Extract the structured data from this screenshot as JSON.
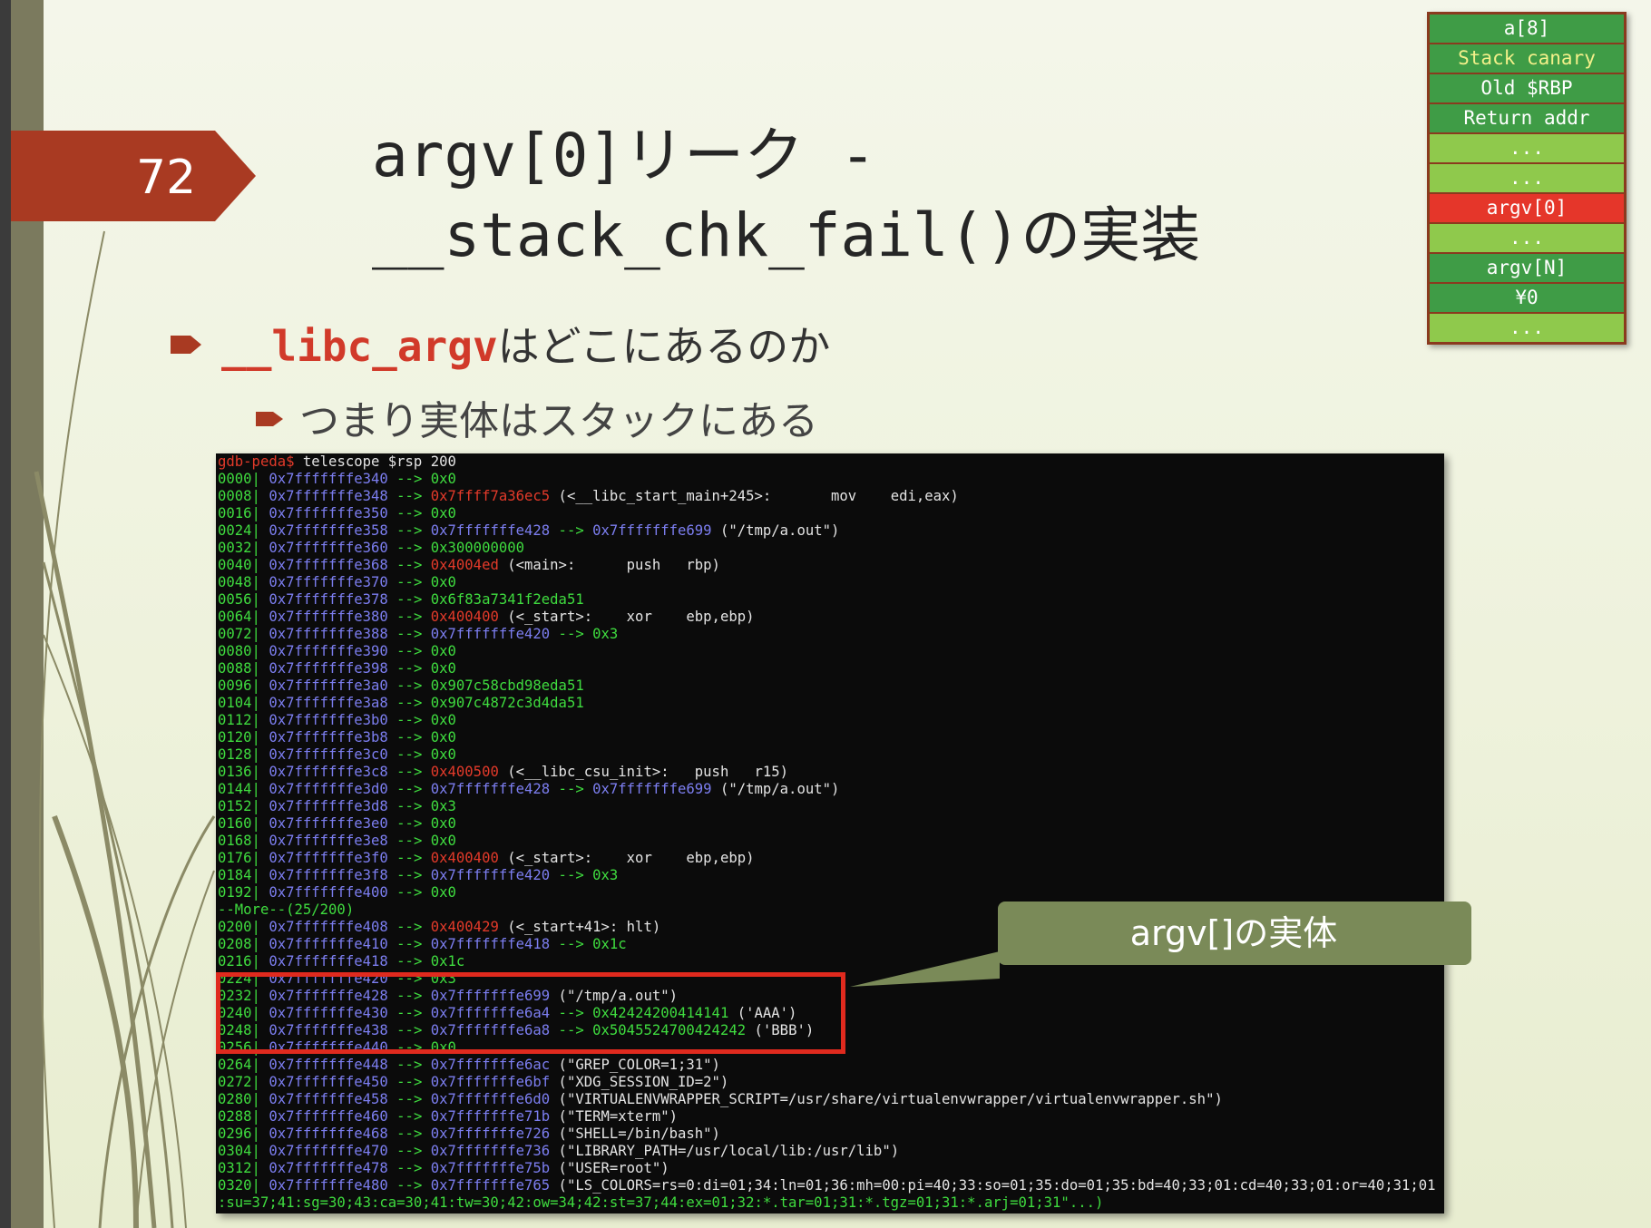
{
  "slide": {
    "number": "72",
    "title_line1": "argv[0]リーク -",
    "title_line2": "__stack_chk_fail()の実装",
    "bullet1_code": "__libc_argv",
    "bullet1_text": "はどこにあるのか",
    "bullet2_text": "つまり実体はスタックにある",
    "callout": "argv[]の実体"
  },
  "colors": {
    "badge": "#a93a22",
    "accent_red": "#d13a2a",
    "stack_dark": "#3f9c46",
    "stack_light": "#8fc94c",
    "stack_red": "#e5362a",
    "stack_border": "#8a3a1e",
    "callout": "#7a8a58",
    "terminal_bg": "#0b0b0b"
  },
  "stack_diagram": [
    {
      "label": "a[8]",
      "style": "dark"
    },
    {
      "label": "Stack canary",
      "style": "dark-yellow"
    },
    {
      "label": "Old $RBP",
      "style": "dark"
    },
    {
      "label": "Return addr",
      "style": "dark"
    },
    {
      "label": "...",
      "style": "light"
    },
    {
      "label": "...",
      "style": "light"
    },
    {
      "label": "argv[0]",
      "style": "red"
    },
    {
      "label": "...",
      "style": "light"
    },
    {
      "label": "argv[N]",
      "style": "dark"
    },
    {
      "label": "¥0",
      "style": "dark"
    },
    {
      "label": "...",
      "style": "light"
    }
  ],
  "terminal": {
    "prompt": "gdb-peda$",
    "command": " telescope $rsp 200",
    "lines": [
      {
        "off": "0000|",
        "addr": " 0x7fffffffe340",
        "arrow": " --> ",
        "v1": "0x0",
        "v1c": "g"
      },
      {
        "off": "0008|",
        "addr": " 0x7fffffffe348",
        "arrow": " --> ",
        "v1": "0x7ffff7a36ec5",
        "v1c": "r",
        "rest": " (<__libc_start_main+245>:       mov    edi,eax)"
      },
      {
        "off": "0016|",
        "addr": " 0x7fffffffe350",
        "arrow": " --> ",
        "v1": "0x0",
        "v1c": "g"
      },
      {
        "off": "0024|",
        "addr": " 0x7fffffffe358",
        "arrow": " --> ",
        "v1": "0x7fffffffe428",
        "v1c": "a",
        "mid": " --> ",
        "v2": "0x7fffffffe699",
        "v2c": "a",
        "rest": " (\"/tmp/a.out\")"
      },
      {
        "off": "0032|",
        "addr": " 0x7fffffffe360",
        "arrow": " --> ",
        "v1": "0x300000000",
        "v1c": "g"
      },
      {
        "off": "0040|",
        "addr": " 0x7fffffffe368",
        "arrow": " --> ",
        "v1": "0x4004ed",
        "v1c": "r",
        "rest": " (<main>:      push   rbp)"
      },
      {
        "off": "0048|",
        "addr": " 0x7fffffffe370",
        "arrow": " --> ",
        "v1": "0x0",
        "v1c": "g"
      },
      {
        "off": "0056|",
        "addr": " 0x7fffffffe378",
        "arrow": " --> ",
        "v1": "0x6f83a7341f2eda51",
        "v1c": "g"
      },
      {
        "off": "0064|",
        "addr": " 0x7fffffffe380",
        "arrow": " --> ",
        "v1": "0x400400",
        "v1c": "r",
        "rest": " (<_start>:    xor    ebp,ebp)"
      },
      {
        "off": "0072|",
        "addr": " 0x7fffffffe388",
        "arrow": " --> ",
        "v1": "0x7fffffffe420",
        "v1c": "a",
        "mid": " --> ",
        "v2": "0x3",
        "v2c": "g"
      },
      {
        "off": "0080|",
        "addr": " 0x7fffffffe390",
        "arrow": " --> ",
        "v1": "0x0",
        "v1c": "g"
      },
      {
        "off": "0088|",
        "addr": " 0x7fffffffe398",
        "arrow": " --> ",
        "v1": "0x0",
        "v1c": "g"
      },
      {
        "off": "0096|",
        "addr": " 0x7fffffffe3a0",
        "arrow": " --> ",
        "v1": "0x907c58cbd98eda51",
        "v1c": "g"
      },
      {
        "off": "0104|",
        "addr": " 0x7fffffffe3a8",
        "arrow": " --> ",
        "v1": "0x907c4872c3d4da51",
        "v1c": "g"
      },
      {
        "off": "0112|",
        "addr": " 0x7fffffffe3b0",
        "arrow": " --> ",
        "v1": "0x0",
        "v1c": "g"
      },
      {
        "off": "0120|",
        "addr": " 0x7fffffffe3b8",
        "arrow": " --> ",
        "v1": "0x0",
        "v1c": "g"
      },
      {
        "off": "0128|",
        "addr": " 0x7fffffffe3c0",
        "arrow": " --> ",
        "v1": "0x0",
        "v1c": "g"
      },
      {
        "off": "0136|",
        "addr": " 0x7fffffffe3c8",
        "arrow": " --> ",
        "v1": "0x400500",
        "v1c": "r",
        "rest": " (<__libc_csu_init>:   push   r15)"
      },
      {
        "off": "0144|",
        "addr": " 0x7fffffffe3d0",
        "arrow": " --> ",
        "v1": "0x7fffffffe428",
        "v1c": "a",
        "mid": " --> ",
        "v2": "0x7fffffffe699",
        "v2c": "a",
        "rest": " (\"/tmp/a.out\")"
      },
      {
        "off": "0152|",
        "addr": " 0x7fffffffe3d8",
        "arrow": " --> ",
        "v1": "0x3",
        "v1c": "g"
      },
      {
        "off": "0160|",
        "addr": " 0x7fffffffe3e0",
        "arrow": " --> ",
        "v1": "0x0",
        "v1c": "g"
      },
      {
        "off": "0168|",
        "addr": " 0x7fffffffe3e8",
        "arrow": " --> ",
        "v1": "0x0",
        "v1c": "g"
      },
      {
        "off": "0176|",
        "addr": " 0x7fffffffe3f0",
        "arrow": " --> ",
        "v1": "0x400400",
        "v1c": "r",
        "rest": " (<_start>:    xor    ebp,ebp)"
      },
      {
        "off": "0184|",
        "addr": " 0x7fffffffe3f8",
        "arrow": " --> ",
        "v1": "0x7fffffffe420",
        "v1c": "a",
        "mid": " --> ",
        "v2": "0x3",
        "v2c": "g"
      },
      {
        "off": "0192|",
        "addr": " 0x7fffffffe400",
        "arrow": " --> ",
        "v1": "0x0",
        "v1c": "g"
      },
      {
        "raw": "--More--(25/200)"
      },
      {
        "off": "0200|",
        "addr": " 0x7fffffffe408",
        "arrow": " --> ",
        "v1": "0x400429",
        "v1c": "r",
        "rest": " (<_start+41>: hlt)"
      },
      {
        "off": "0208|",
        "addr": " 0x7fffffffe410",
        "arrow": " --> ",
        "v1": "0x7fffffffe418",
        "v1c": "a",
        "mid": " --> ",
        "v2": "0x1c",
        "v2c": "g"
      },
      {
        "off": "0216|",
        "addr": " 0x7fffffffe418",
        "arrow": " --> ",
        "v1": "0x1c",
        "v1c": "g"
      },
      {
        "off": "0224|",
        "addr": " 0x7fffffffe420",
        "arrow": " --> ",
        "v1": "0x3",
        "v1c": "g"
      },
      {
        "off": "0232|",
        "addr": " 0x7fffffffe428",
        "arrow": " --> ",
        "v1": "0x7fffffffe699",
        "v1c": "a",
        "rest": " (\"/tmp/a.out\")"
      },
      {
        "off": "0240|",
        "addr": " 0x7fffffffe430",
        "arrow": " --> ",
        "v1": "0x7fffffffe6a4",
        "v1c": "a",
        "mid": " --> ",
        "v2": "0x42424200414141",
        "v2c": "g",
        "rest": " ('AAA')"
      },
      {
        "off": "0248|",
        "addr": " 0x7fffffffe438",
        "arrow": " --> ",
        "v1": "0x7fffffffe6a8",
        "v1c": "a",
        "mid": " --> ",
        "v2": "0x5045524700424242",
        "v2c": "g",
        "rest": " ('BBB')"
      },
      {
        "off": "0256|",
        "addr": " 0x7fffffffe440",
        "arrow": " --> ",
        "v1": "0x0",
        "v1c": "g"
      },
      {
        "off": "0264|",
        "addr": " 0x7fffffffe448",
        "arrow": " --> ",
        "v1": "0x7fffffffe6ac",
        "v1c": "a",
        "rest": " (\"GREP_COLOR=1;31\")"
      },
      {
        "off": "0272|",
        "addr": " 0x7fffffffe450",
        "arrow": " --> ",
        "v1": "0x7fffffffe6bf",
        "v1c": "a",
        "rest": " (\"XDG_SESSION_ID=2\")"
      },
      {
        "off": "0280|",
        "addr": " 0x7fffffffe458",
        "arrow": " --> ",
        "v1": "0x7fffffffe6d0",
        "v1c": "a",
        "rest": " (\"VIRTUALENVWRAPPER_SCRIPT=/usr/share/virtualenvwrapper/virtualenvwrapper.sh\")"
      },
      {
        "off": "0288|",
        "addr": " 0x7fffffffe460",
        "arrow": " --> ",
        "v1": "0x7fffffffe71b",
        "v1c": "a",
        "rest": " (\"TERM=xterm\")"
      },
      {
        "off": "0296|",
        "addr": " 0x7fffffffe468",
        "arrow": " --> ",
        "v1": "0x7fffffffe726",
        "v1c": "a",
        "rest": " (\"SHELL=/bin/bash\")"
      },
      {
        "off": "0304|",
        "addr": " 0x7fffffffe470",
        "arrow": " --> ",
        "v1": "0x7fffffffe736",
        "v1c": "a",
        "rest": " (\"LIBRARY_PATH=/usr/local/lib:/usr/lib\")"
      },
      {
        "off": "0312|",
        "addr": " 0x7fffffffe478",
        "arrow": " --> ",
        "v1": "0x7fffffffe75b",
        "v1c": "a",
        "rest": " (\"USER=root\")"
      },
      {
        "off": "0320|",
        "addr": " 0x7fffffffe480",
        "arrow": " --> ",
        "v1": "0x7fffffffe765",
        "v1c": "a",
        "rest": " (\"LS_COLORS=rs=0:di=01;34:ln=01;36:mh=00:pi=40;33:so=01;35:do=01;35:bd=40;33;01:cd=40;33;01:or=40;31;01"
      },
      {
        "raw": ":su=37;41:sg=30;43:ca=30;41:tw=30;42:ow=34;42:st=37;44:ex=01;32:*.tar=01;31:*.tgz=01;31:*.arj=01;31\"...)"
      }
    ]
  }
}
